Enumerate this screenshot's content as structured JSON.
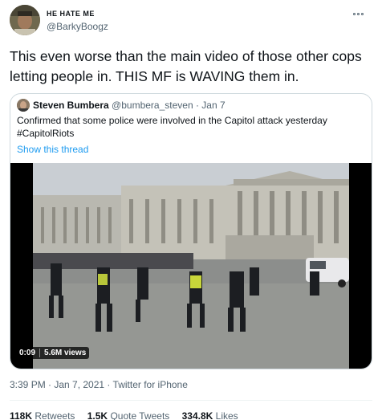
{
  "user": {
    "display_name": "HE HATE ME",
    "handle": "@BarkyBoogz"
  },
  "tweet": {
    "text": "This even worse than the main video of those other cops letting people in. THIS MF is WAVING them in.",
    "timestamp": "3:39 PM · Jan 7, 2021 · Twitter for iPhone"
  },
  "quoted": {
    "name": "Steven Bumbera",
    "handle": "@bumbera_steven",
    "date": "· Jan 7",
    "text": "Confirmed that some police were involved in the Capitol attack yesterday #CapitolRiots",
    "show_thread": "Show this thread"
  },
  "video": {
    "duration": "0:09",
    "views": "5.6M views"
  },
  "stats": {
    "retweets_count": "118K",
    "retweets_label": "Retweets",
    "quotes_count": "1.5K",
    "quotes_label": "Quote Tweets",
    "likes_count": "334.8K",
    "likes_label": "Likes"
  },
  "colors": {
    "link": "#1d9bf0",
    "secondary_text": "#536471",
    "border": "#cfd9de"
  },
  "icons": [
    "more-icon"
  ]
}
